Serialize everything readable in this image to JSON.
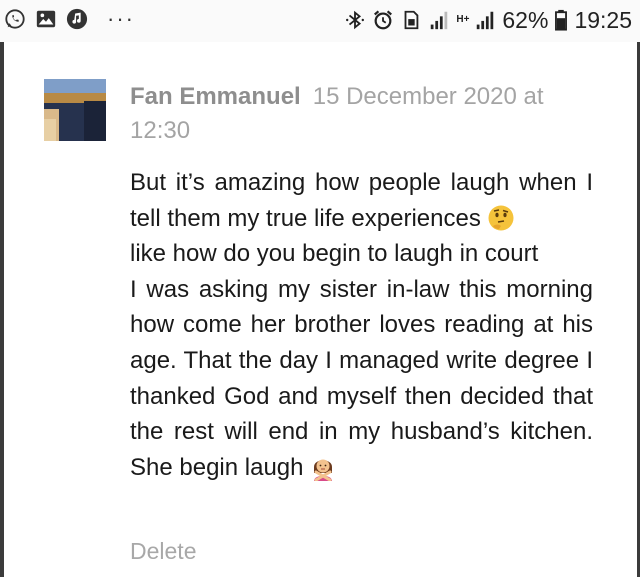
{
  "status_bar": {
    "left_icons": [
      "whatsapp-icon",
      "gallery-icon",
      "music-icon"
    ],
    "overflow": "···",
    "right_icons": [
      "bluetooth-icon",
      "alarm-icon",
      "sim-icon",
      "signal-icon",
      "signal-icon"
    ],
    "network_label": "H+",
    "battery": "62%",
    "time": "19:25"
  },
  "comment": {
    "author": "Fan Emmanuel",
    "timestamp": "15 December 2020 at 12:30",
    "line1": "But it’s amazing how people laugh when I tell them my true life experiences",
    "line2": "like how do you begin to laugh in court",
    "paragraph": "I was asking my sister in-law this morning how come her brother loves reading at his age. That the day I managed write degree I thanked God and myself then decided that the rest will end in my husband’s kitchen. She begin laugh",
    "emoji_1": "thinking-face-emoji",
    "emoji_2": "woman-gesturing-no-emoji",
    "delete_label": "Delete"
  },
  "colors": {
    "author": "#8e8e8e",
    "timestamp": "#a4a4a4",
    "body_text": "#1a1a1a",
    "delete": "#a8a8a8",
    "frame": "#3b3b3b"
  }
}
